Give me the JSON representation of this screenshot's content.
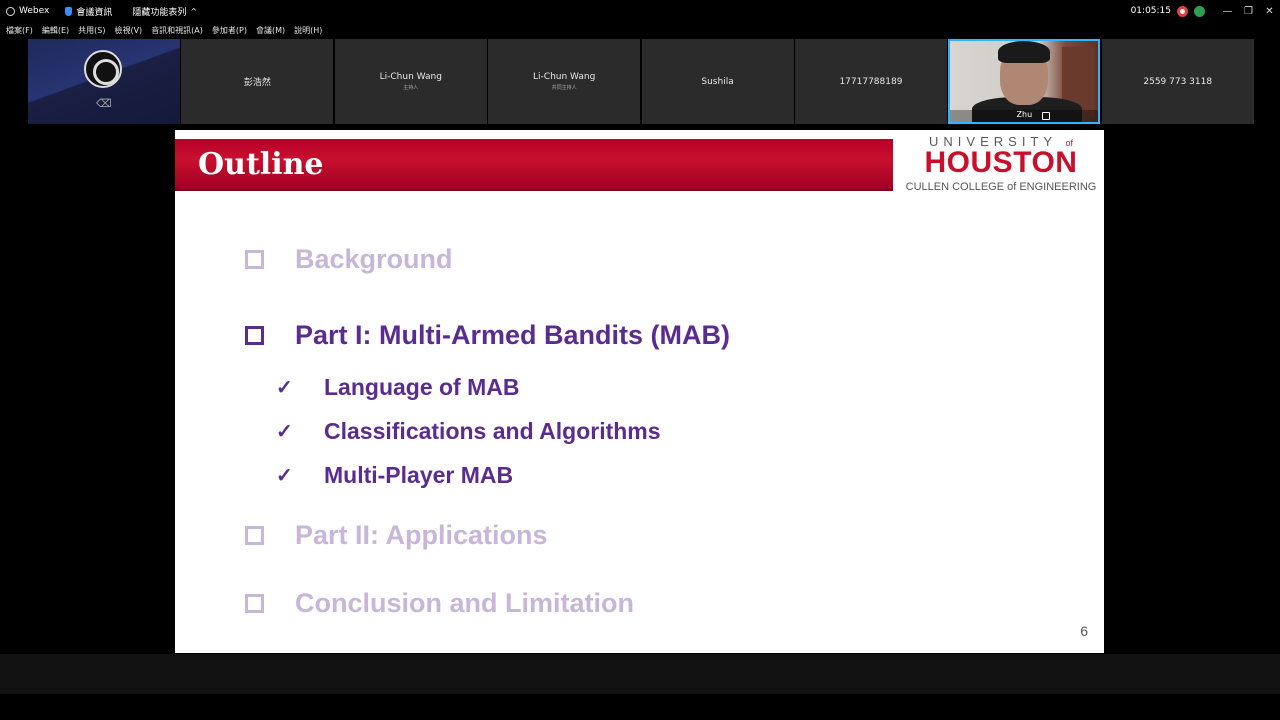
{
  "titlebar": {
    "app_name": "Webex",
    "meeting_info": "會議資訊",
    "hide_toolbar": "隱藏功能表列",
    "caret": "^",
    "timer": "01:05:15"
  },
  "menu": [
    "檔案(F)",
    "編輯(E)",
    "共用(S)",
    "檢視(V)",
    "音訊和視訊(A)",
    "參加者(P)",
    "會議(M)",
    "說明(H)"
  ],
  "participants": [
    {
      "name": "",
      "role": ""
    },
    {
      "name": "彭浩然",
      "role": ""
    },
    {
      "name": "Li-Chun Wang",
      "role": "主持人"
    },
    {
      "name": "Li-Chun Wang",
      "role": "共同主持人"
    },
    {
      "name": "Sushila",
      "role": ""
    },
    {
      "name": "17717788189",
      "role": ""
    },
    {
      "name": "Zhu",
      "role": ""
    },
    {
      "name": "2559 773 3118",
      "role": ""
    }
  ],
  "slide": {
    "title": "Outline",
    "logo": {
      "university": "UNIVERSITY",
      "of": "of",
      "houston": "HOUSTON",
      "college": "CULLEN COLLEGE of ENGINEERING"
    },
    "items": [
      {
        "label": "Background",
        "state": "dim"
      },
      {
        "label": "Part I: Multi-Armed Bandits (MAB)",
        "state": "active"
      },
      {
        "label": "Part II: Applications",
        "state": "dim"
      },
      {
        "label": "Conclusion and Limitation",
        "state": "dim"
      }
    ],
    "subitems": [
      "Language of MAB",
      "Classifications and Algorithms",
      "Multi-Player MAB"
    ],
    "page_number": "6"
  },
  "colors": {
    "uh_red": "#c8102e",
    "outline_purple": "#5b2c8f",
    "dim_purple": "#c7b6d8",
    "active_speaker_border": "#2fb4ff"
  }
}
